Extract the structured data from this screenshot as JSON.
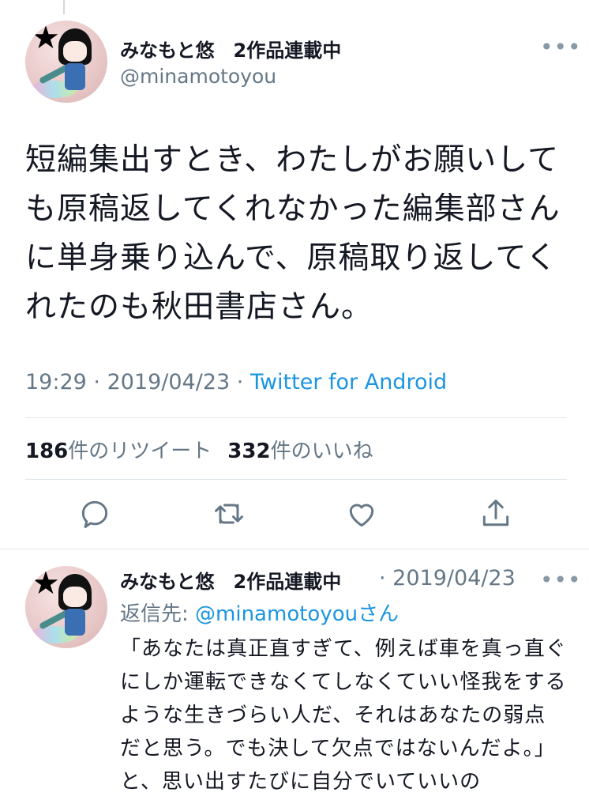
{
  "main_tweet": {
    "display_name": "みなもと悠　2作品連載中",
    "handle": "@minamotoyou",
    "text": "短編集出すとき、わたしがお願いしても原稿返してくれなかった編集部さんに単身乗り込んで、原稿取り返してくれたのも秋田書店さん。",
    "time": "19:29",
    "date": "2019/04/23",
    "separator": " · ",
    "source": "Twitter for Android",
    "retweet_count": "186",
    "retweet_label": "件のリツイート",
    "like_count": "332",
    "like_label": "件のいいね",
    "more_icon": "•••"
  },
  "actions": [
    "reply-icon",
    "retweet-icon",
    "like-icon",
    "share-icon"
  ],
  "reply_tweet": {
    "display_name": "みなもと悠　2作品連載中",
    "date_text": "· 2019/04/23",
    "reply_prefix": "返信先: ",
    "reply_mention": "@minamotoyou",
    "reply_suffix": "さん",
    "text": "「あなたは真正直すぎて、例えば車を真っ直ぐにしか運転できなくてしなくていい怪我をするような生きづらい人だ、それはあなたの弱点だと思う。でも決して欠点ではないんだよ。」と、思い出すたびに自分でいていいの",
    "more_icon": "•••"
  },
  "colors": {
    "text": "#141823",
    "secondary": "#657786",
    "link": "#1b95e0",
    "divider": "#e1e8ed"
  }
}
